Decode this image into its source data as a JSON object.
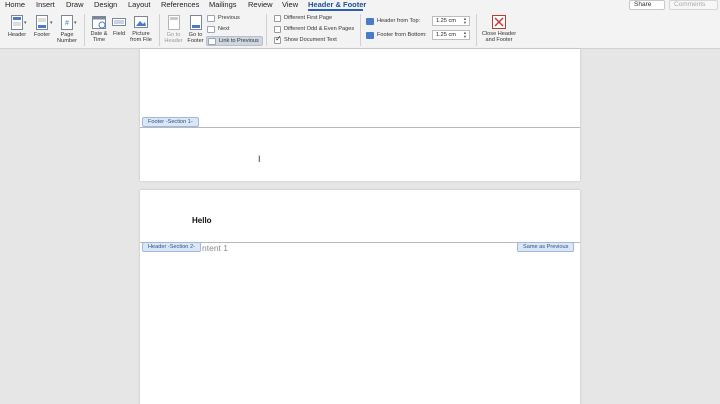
{
  "ribbon_tabs": {
    "home": "Home",
    "insert": "Insert",
    "draw": "Draw",
    "design": "Design",
    "layout": "Layout",
    "references": "References",
    "mailings": "Mailings",
    "review": "Review",
    "view": "View",
    "header_footer": "Header & Footer"
  },
  "top_right": {
    "share": "Share",
    "comments": "Comments"
  },
  "toolbar": {
    "header": "Header",
    "footer": "Footer",
    "page_number_l1": "Page",
    "page_number_l2": "Number",
    "date_time_l1": "Date &",
    "date_time_l2": "Time",
    "field": "Field",
    "picture_l1": "Picture",
    "picture_l2": "from File",
    "go_header_l1": "Go to",
    "go_header_l2": "Header",
    "go_footer_l1": "Go to",
    "go_footer_l2": "Footer",
    "previous": "Previous",
    "next": "Next",
    "link_previous": "Link to Previous",
    "diff_first": "Different First Page",
    "diff_odd_even": "Different Odd & Even Pages",
    "show_doc_text": "Show Document Text",
    "header_from_top_label": "Header from Top:",
    "header_from_top_value": "1.25 cm",
    "footer_from_bottom_label": "Footer from Bottom:",
    "footer_from_bottom_value": "1.25 cm",
    "close_l1": "Close Header",
    "close_l2": "and Footer"
  },
  "checkboxes": {
    "diff_first": false,
    "diff_odd_even": false,
    "show_doc_text": true
  },
  "document": {
    "footer_tag_1": "Footer -Section 1-",
    "header_tag_2": "Header -Section 2-",
    "same_as_previous": "Same as Previous",
    "header_text": "Hello",
    "body_text": "ntent 1"
  },
  "colors": {
    "accent": "#2b5fb4",
    "tag_bg": "#dce7f5",
    "close_red": "#c0392b"
  }
}
